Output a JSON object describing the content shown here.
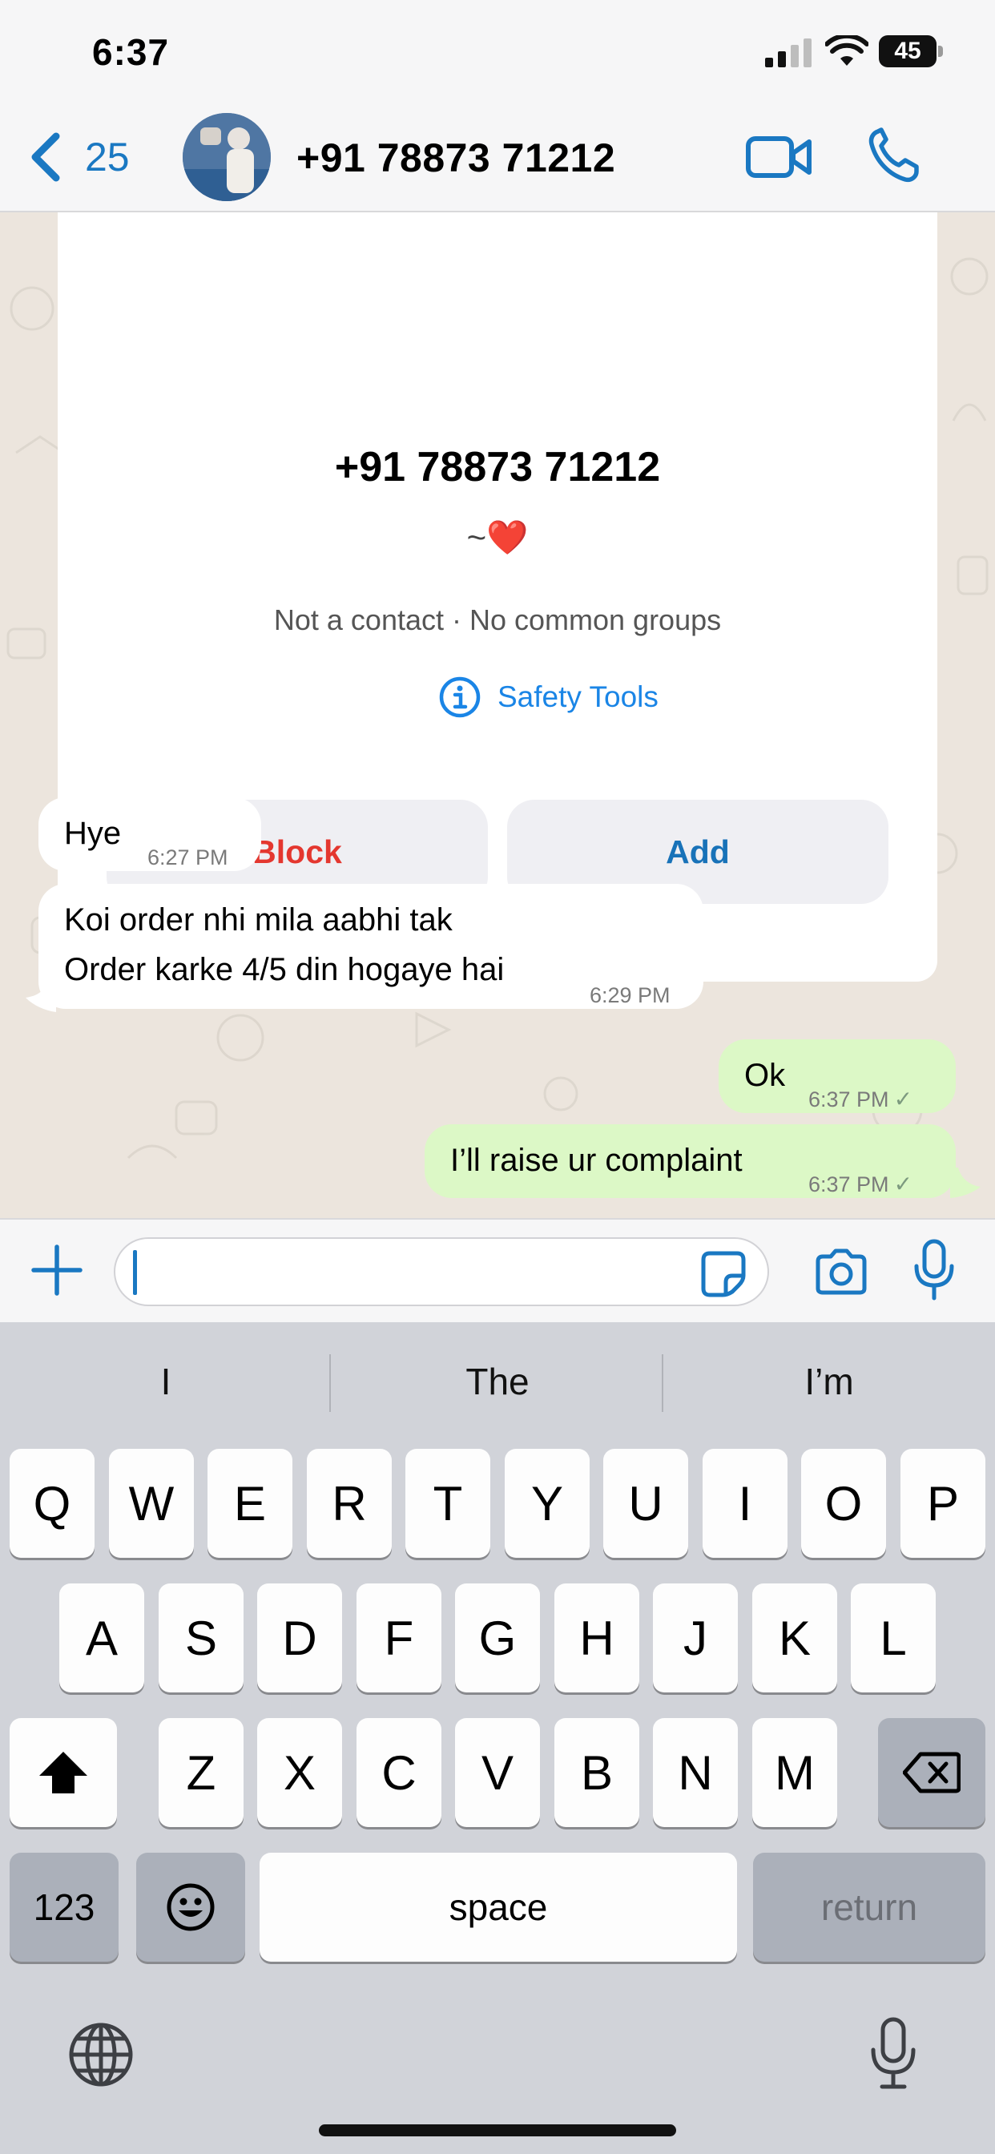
{
  "status_bar": {
    "time": "6:37",
    "battery": "45",
    "icons": [
      "cellular-signal-icon",
      "wifi-icon",
      "battery-icon"
    ]
  },
  "header": {
    "back_count": "25",
    "contact_name": "+91 78873 71212",
    "icons": [
      "back-chevron-icon",
      "video-call-icon",
      "voice-call-icon"
    ]
  },
  "contact_card": {
    "phone": "+91 78873 71212",
    "status_prefix": "~",
    "status_emoji": "❤️",
    "meta": "Not a contact · No common groups",
    "safety_tools_label": "Safety Tools",
    "block_label": "Block",
    "add_label": "Add"
  },
  "messages": [
    {
      "direction": "incoming",
      "lines": [
        "Hye"
      ],
      "time": "6:27 PM"
    },
    {
      "direction": "incoming",
      "lines": [
        "Koi order nhi mila aabhi tak",
        "Order karke  4/5 din hogaye hai"
      ],
      "time": "6:29 PM"
    },
    {
      "direction": "outgoing",
      "lines": [
        "Ok"
      ],
      "time": "6:37 PM",
      "tick": "✓"
    },
    {
      "direction": "outgoing",
      "lines": [
        "I’ll raise ur complaint"
      ],
      "time": "6:37 PM",
      "tick": "✓"
    }
  ],
  "composer": {
    "value": "",
    "icons": [
      "plus-icon",
      "sticker-icon",
      "camera-icon",
      "microphone-icon"
    ]
  },
  "keyboard": {
    "suggestions": [
      "I",
      "The",
      "I’m"
    ],
    "row1": [
      "Q",
      "W",
      "E",
      "R",
      "T",
      "Y",
      "U",
      "I",
      "O",
      "P"
    ],
    "row2": [
      "A",
      "S",
      "D",
      "F",
      "G",
      "H",
      "J",
      "K",
      "L"
    ],
    "row3": [
      "Z",
      "X",
      "C",
      "V",
      "B",
      "N",
      "M"
    ],
    "numbers_label": "123",
    "space_label": "space",
    "return_label": "return",
    "icons": [
      "shift-icon",
      "delete-icon",
      "emoji-icon",
      "globe-icon",
      "dictation-mic-icon"
    ]
  },
  "colors": {
    "accent": "#1a78c2",
    "block_red": "#e4372f",
    "outgoing_bubble": "#dcf8c6",
    "chat_background": "#ece5dd"
  }
}
